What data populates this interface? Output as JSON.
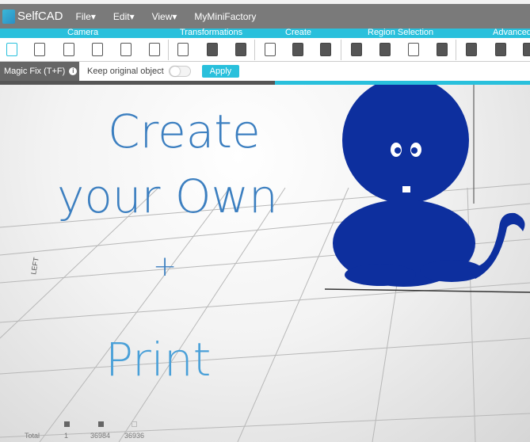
{
  "app": {
    "name": "SelfCAD"
  },
  "menu": [
    {
      "label": "File▾"
    },
    {
      "label": "Edit▾"
    },
    {
      "label": "View▾"
    },
    {
      "label": "MyMiniFactory"
    }
  ],
  "sections": [
    "Camera",
    "Transformations",
    "Create",
    "Region Selection",
    "Advanced"
  ],
  "magic": {
    "label": "Magic Fix (T+F)",
    "info": "i",
    "keep_label": "Keep original object",
    "keep_value": false,
    "apply": "Apply"
  },
  "viewport": {
    "line1": "Create",
    "line2": "your Own",
    "plus": "+",
    "line3": "Print",
    "axis_label": "LEFT"
  },
  "stats": {
    "label": "Total",
    "objects": "1",
    "faces": "36984",
    "vertices": "36936"
  },
  "colors": {
    "accent": "#29c0dc",
    "model": "#0d2f9e",
    "text": "#3c7fc0"
  }
}
